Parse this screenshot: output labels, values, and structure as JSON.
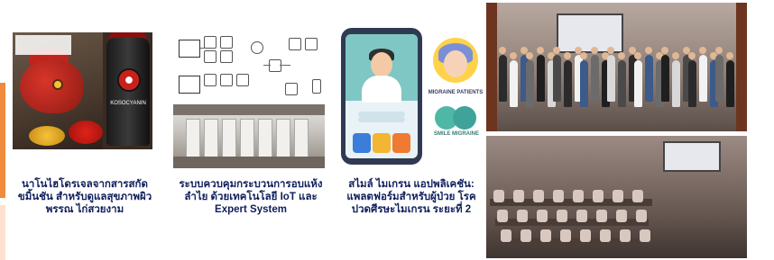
{
  "captions": {
    "panel1": "นาโนไฮโดรเจลจากสารสกัดขมิ้นชัน สำหรับดูแลสุขภาพผิวพรรณ ไก่สวยงาม",
    "panel2": "ระบบควบคุมกระบวนการอบแห้ง ลำไย ด้วยเทคโนโลยี IoT และ Expert System",
    "panel3": "สไมล์ ไมเกรน แอปพลิเคชัน: แพลตฟอร์มสำหรับผู้ป่วย โรคปวดศีรษะไมเกรน ระยะที่ 2"
  },
  "product": {
    "tube_brand": "KOSOCYANIN"
  },
  "logos": {
    "migraine_patients": "MIGRAINE PATIENTS",
    "smile_migraine": "SMILE MIGRAINE"
  },
  "colors": {
    "accent_orange": "#f08a3c",
    "accent_light": "#fde2d2",
    "caption_navy": "#0f1f5c",
    "app_blue": "#3b7dd8",
    "app_yellow": "#f2b632",
    "app_orange": "#ef7a32"
  }
}
